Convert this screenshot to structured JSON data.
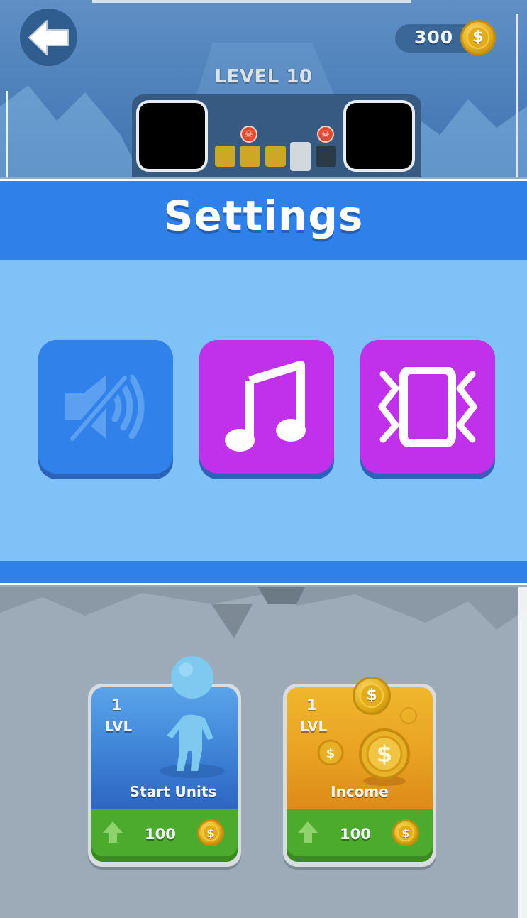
{
  "hud": {
    "back_icon": "arrow-left-icon",
    "coins": "300",
    "level_label": "LEVEL 10",
    "progress": {
      "done_steps": 3,
      "current_step": 1,
      "remaining_steps": 1
    },
    "colors": {
      "done": "#cda825",
      "current": "#d3d8dd",
      "todo": "#2b3a47"
    }
  },
  "settings": {
    "title": "Settings",
    "buttons": [
      {
        "name": "sound",
        "icon": "speaker-muted-icon",
        "enabled": false,
        "color": "#3081ea"
      },
      {
        "name": "music",
        "icon": "music-note-icon",
        "enabled": true,
        "color": "#c130ea"
      },
      {
        "name": "vibration",
        "icon": "vibration-icon",
        "enabled": true,
        "color": "#c130ea"
      }
    ]
  },
  "upgrades": [
    {
      "id": "start-units",
      "level": "1",
      "level_label": "LVL",
      "name": "Start Units",
      "price": "100",
      "theme": "blue",
      "upgrade_icon": "arrow-up-icon"
    },
    {
      "id": "income",
      "level": "1",
      "level_label": "LVL",
      "name": "Income",
      "price": "100",
      "theme": "gold",
      "upgrade_icon": "arrow-up-icon"
    }
  ],
  "currency_symbol": "$"
}
